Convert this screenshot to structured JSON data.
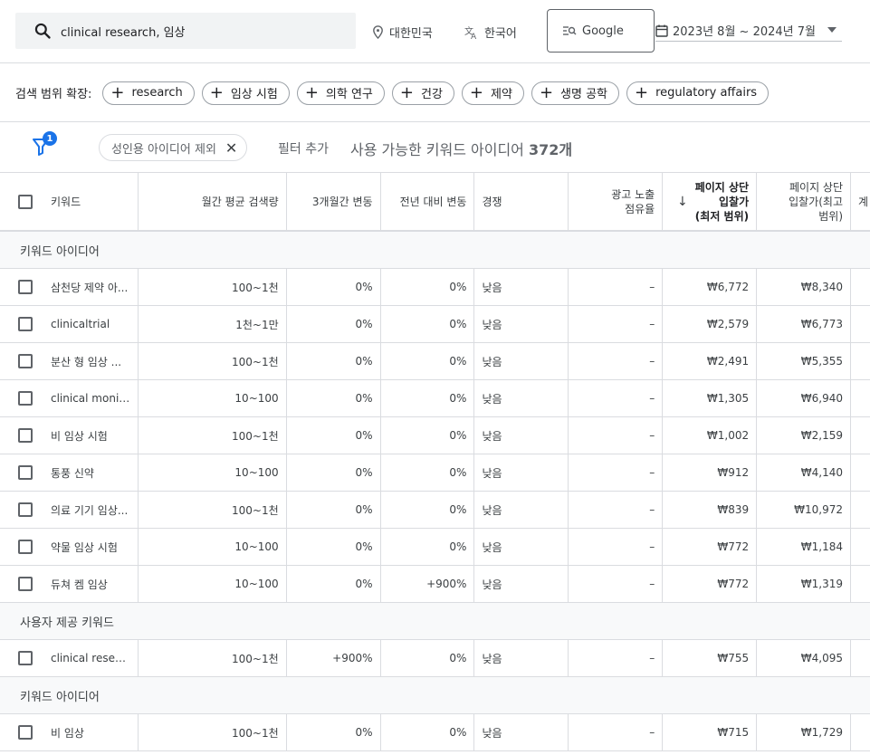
{
  "search": {
    "value": "clinical research, 임상"
  },
  "location": "대한민국",
  "language": "한국어",
  "engine": "Google",
  "date_range": "2023년 8월 ~ 2024년 7월",
  "expand": {
    "label": "검색 범위 확장:",
    "chips": [
      "research",
      "임상 시험",
      "의학 연구",
      "건강",
      "제약",
      "생명 공학",
      "regulatory affairs"
    ]
  },
  "filter": {
    "badge": "1",
    "active_chip": "성인용 아이디어 제외",
    "add_filter": "필터 추가",
    "available_prefix": "사용 가능한 키워드 아이디어",
    "available_count": "372개"
  },
  "columns": {
    "keyword": "키워드",
    "volume": "월간 평균 검색량",
    "three_month": "3개월간 변동",
    "yoy": "전년 대비 변동",
    "competition": "경쟁",
    "impression_share_1": "광고 노출",
    "impression_share_2": "점유율",
    "top_low_1": "페이지 상단",
    "top_low_2": "입찰가",
    "top_low_3": "(최저 범위)",
    "top_high_1": "페이지 상단",
    "top_high_2": "입찰가(최고",
    "top_high_3": "범위)",
    "account": "계"
  },
  "groups": [
    {
      "title": "키워드 아이디어",
      "rows": [
        {
          "keyword": "삼천당 제약 아...",
          "volume": "100~1천",
          "three_month": "0%",
          "yoy": "0%",
          "competition": "낮음",
          "share": "–",
          "low": "₩6,772",
          "high": "₩8,340"
        },
        {
          "keyword": "clinicaltrial",
          "volume": "1천~1만",
          "three_month": "0%",
          "yoy": "0%",
          "competition": "낮음",
          "share": "–",
          "low": "₩2,579",
          "high": "₩6,773"
        },
        {
          "keyword": "분산 형 임상 ...",
          "volume": "100~1천",
          "three_month": "0%",
          "yoy": "0%",
          "competition": "낮음",
          "share": "–",
          "low": "₩2,491",
          "high": "₩5,355"
        },
        {
          "keyword": "clinical monitor",
          "volume": "10~100",
          "three_month": "0%",
          "yoy": "0%",
          "competition": "낮음",
          "share": "–",
          "low": "₩1,305",
          "high": "₩6,940"
        },
        {
          "keyword": "비 임상 시험",
          "volume": "100~1천",
          "three_month": "0%",
          "yoy": "0%",
          "competition": "낮음",
          "share": "–",
          "low": "₩1,002",
          "high": "₩2,159"
        },
        {
          "keyword": "통풍 신약",
          "volume": "10~100",
          "three_month": "0%",
          "yoy": "0%",
          "competition": "낮음",
          "share": "–",
          "low": "₩912",
          "high": "₩4,140"
        },
        {
          "keyword": "의료 기기 임상...",
          "volume": "100~1천",
          "three_month": "0%",
          "yoy": "0%",
          "competition": "낮음",
          "share": "–",
          "low": "₩839",
          "high": "₩10,972"
        },
        {
          "keyword": "약물 임상 시험",
          "volume": "10~100",
          "three_month": "0%",
          "yoy": "0%",
          "competition": "낮음",
          "share": "–",
          "low": "₩772",
          "high": "₩1,184"
        },
        {
          "keyword": "듀쳐 켐 임상",
          "volume": "10~100",
          "three_month": "0%",
          "yoy": "+900%",
          "competition": "낮음",
          "share": "–",
          "low": "₩772",
          "high": "₩1,319"
        }
      ]
    },
    {
      "title": "사용자 제공 키워드",
      "rows": [
        {
          "keyword": "clinical research",
          "volume": "100~1천",
          "three_month": "+900%",
          "yoy": "0%",
          "competition": "낮음",
          "share": "–",
          "low": "₩755",
          "high": "₩4,095"
        }
      ]
    },
    {
      "title": "키워드 아이디어",
      "rows": [
        {
          "keyword": "비 임상",
          "volume": "100~1천",
          "three_month": "0%",
          "yoy": "0%",
          "competition": "낮음",
          "share": "–",
          "low": "₩715",
          "high": "₩1,729"
        }
      ]
    }
  ]
}
